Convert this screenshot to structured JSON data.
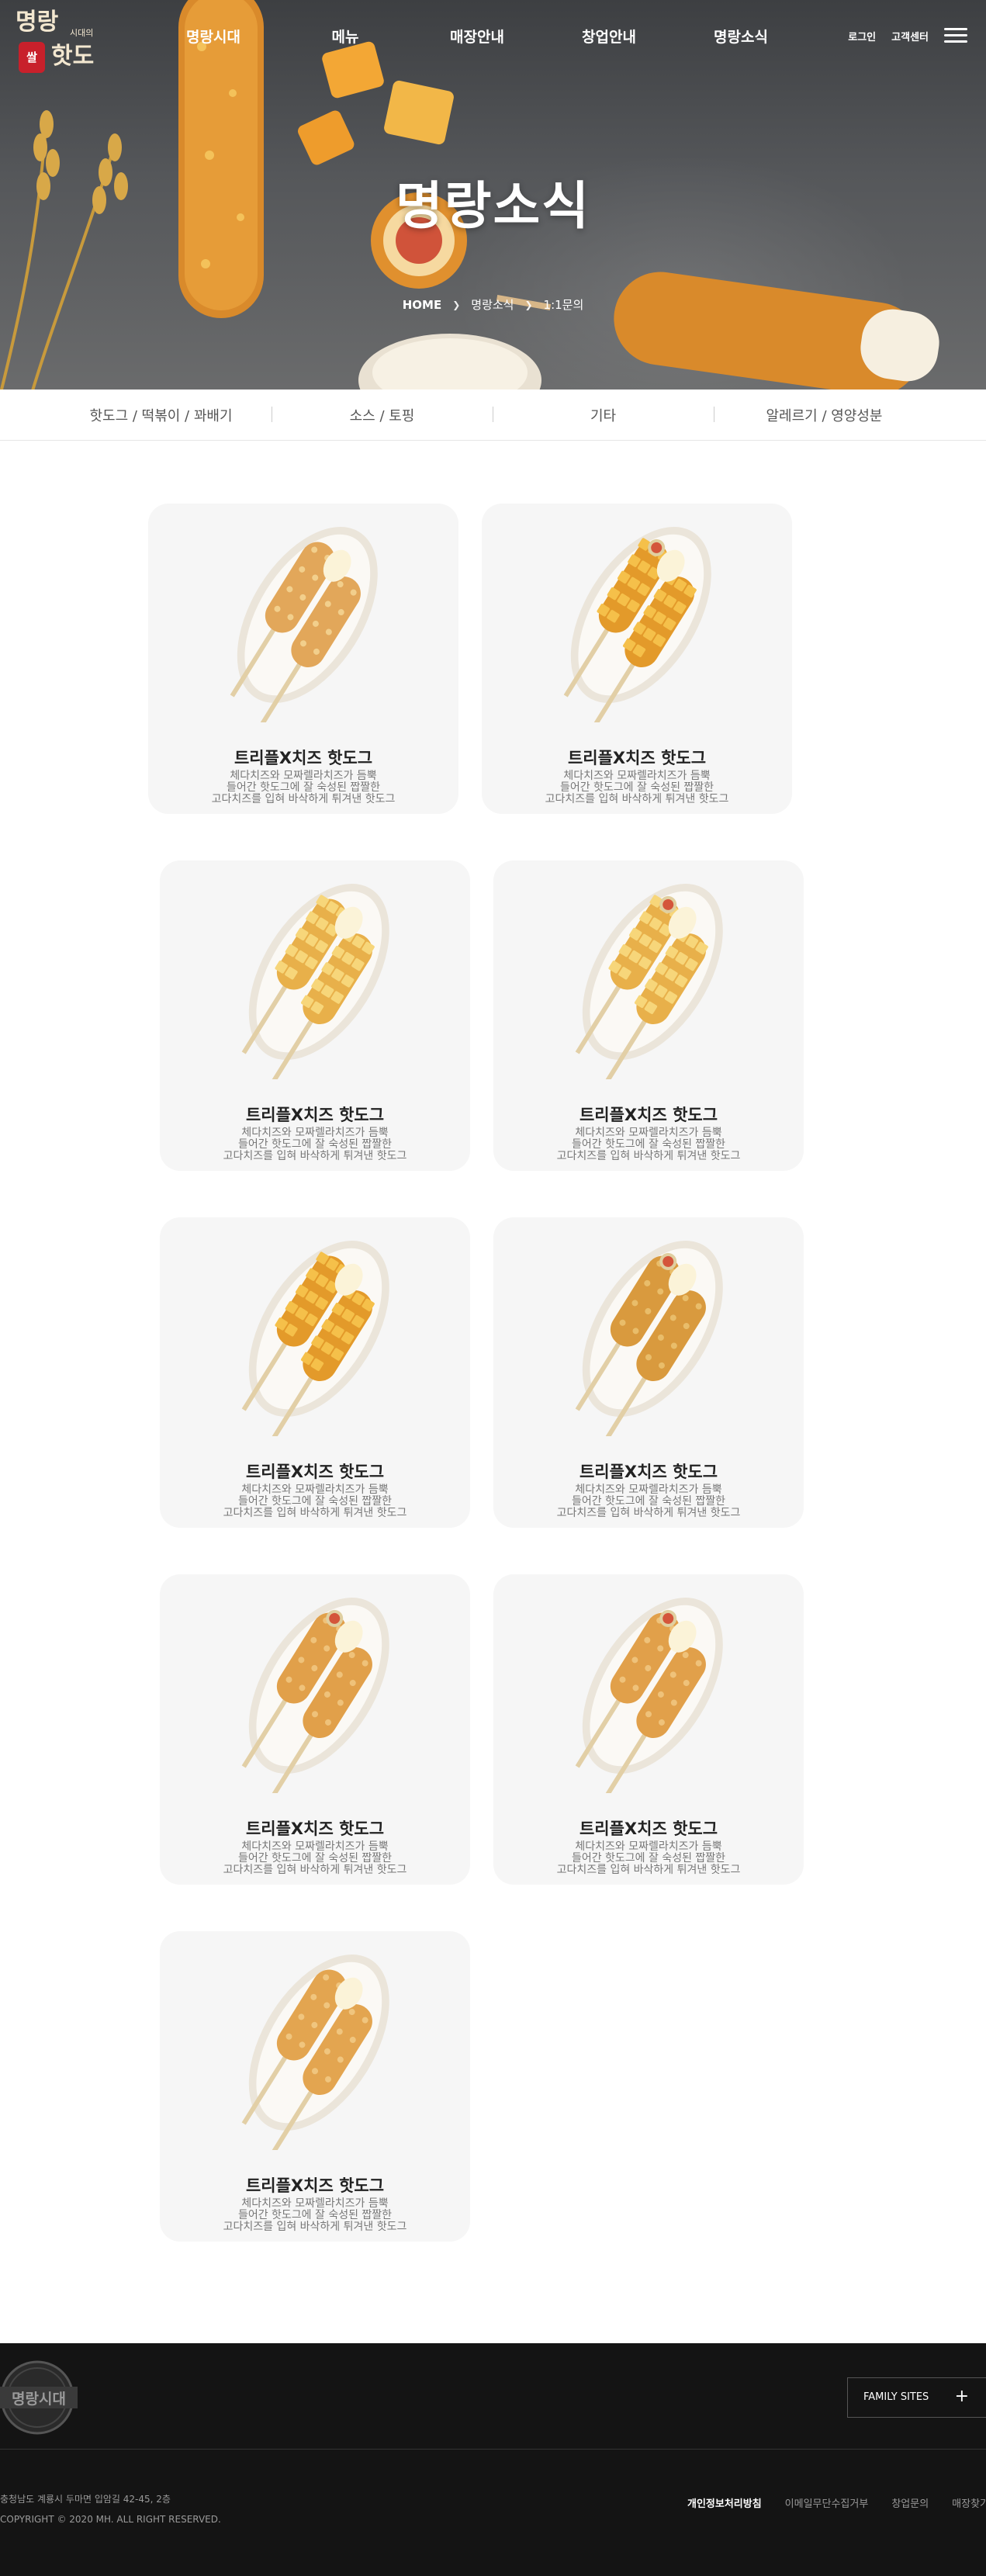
{
  "header": {
    "logo_lines": [
      "명랑",
      "핫도"
    ],
    "logo_small": "시대의",
    "logo_badge": "쌀",
    "nav": [
      "명랑시대",
      "메뉴",
      "매장안내",
      "창업안내",
      "명랑소식"
    ],
    "util": {
      "login": "로그인",
      "support": "고객센터"
    }
  },
  "hero": {
    "title": "명랑소식",
    "breadcrumb": {
      "home": "HOME",
      "section": "명랑소식",
      "current": "1:1문의"
    }
  },
  "subnav": [
    "핫도그 / 떡볶이 / 꽈배기",
    "소스 / 토핑",
    "기타",
    "알레르기 / 영양성분"
  ],
  "products": [
    {
      "name": "트리플X치즈 핫도그",
      "desc": [
        "체다치즈와 모짜렐라치즈가 듬뿍",
        "들어간 핫도그에 잘 숙성된 짭짤한",
        "고다치즈를 입혀 바삭하게 튀겨낸 핫도그"
      ]
    },
    {
      "name": "트리플X치즈 핫도그",
      "desc": [
        "체다치즈와 모짜렐라치즈가 듬뿍",
        "들어간 핫도그에 잘 숙성된 짭짤한",
        "고다치즈를 입혀 바삭하게 튀겨낸 핫도그"
      ]
    },
    {
      "name": "트리플X치즈 핫도그",
      "desc": [
        "체다치즈와 모짜렐라치즈가 듬뿍",
        "들어간 핫도그에 잘 숙성된 짭짤한",
        "고다치즈를 입혀 바삭하게 튀겨낸 핫도그"
      ]
    },
    {
      "name": "트리플X치즈 핫도그",
      "desc": [
        "체다치즈와 모짜렐라치즈가 듬뿍",
        "들어간 핫도그에 잘 숙성된 짭짤한",
        "고다치즈를 입혀 바삭하게 튀겨낸 핫도그"
      ]
    },
    {
      "name": "트리플X치즈 핫도그",
      "desc": [
        "체다치즈와 모짜렐라치즈가 듬뿍",
        "들어간 핫도그에 잘 숙성된 짭짤한",
        "고다치즈를 입혀 바삭하게 튀겨낸 핫도그"
      ]
    },
    {
      "name": "트리플X치즈 핫도그",
      "desc": [
        "체다치즈와 모짜렐라치즈가 듬뿍",
        "들어간 핫도그에 잘 숙성된 짭짤한",
        "고다치즈를 입혀 바삭하게 튀겨낸 핫도그"
      ]
    },
    {
      "name": "트리플X치즈 핫도그",
      "desc": [
        "체다치즈와 모짜렐라치즈가 듬뿍",
        "들어간 핫도그에 잘 숙성된 짭짤한",
        "고다치즈를 입혀 바삭하게 튀겨낸 핫도그"
      ]
    },
    {
      "name": "트리플X치즈 핫도그",
      "desc": [
        "체다치즈와 모짜렐라치즈가 듬뿍",
        "들어간 핫도그에 잘 숙성된 짭짤한",
        "고다치즈를 입혀 바삭하게 튀겨낸 핫도그"
      ]
    },
    {
      "name": "트리플X치즈 핫도그",
      "desc": [
        "체다치즈와 모짜렐라치즈가 듬뿍",
        "들어간 핫도그에 잘 숙성된 짭짤한",
        "고다치즈를 입혀 바삭하게 튀겨낸 핫도그"
      ]
    }
  ],
  "footer": {
    "logo_text": "명랑시대",
    "family_sites": "FAMILY SITES",
    "address": "충청남도 계룡시 두마면 입암길 42-45, 2층",
    "copyright": "COPYRIGHT © 2020 MH. ALL RIGHT RESERVED.",
    "links": [
      "개인정보처리방침",
      "이메일무단수집거부",
      "창업문의",
      "매장찾기"
    ]
  },
  "colors": {
    "badge_red": "#c8202b",
    "footer_bg": "#141414",
    "card_bg": "#f6f6f6"
  },
  "icons": [
    "hamburger-menu-icon",
    "breadcrumb-chevron-icon",
    "plus-icon"
  ]
}
